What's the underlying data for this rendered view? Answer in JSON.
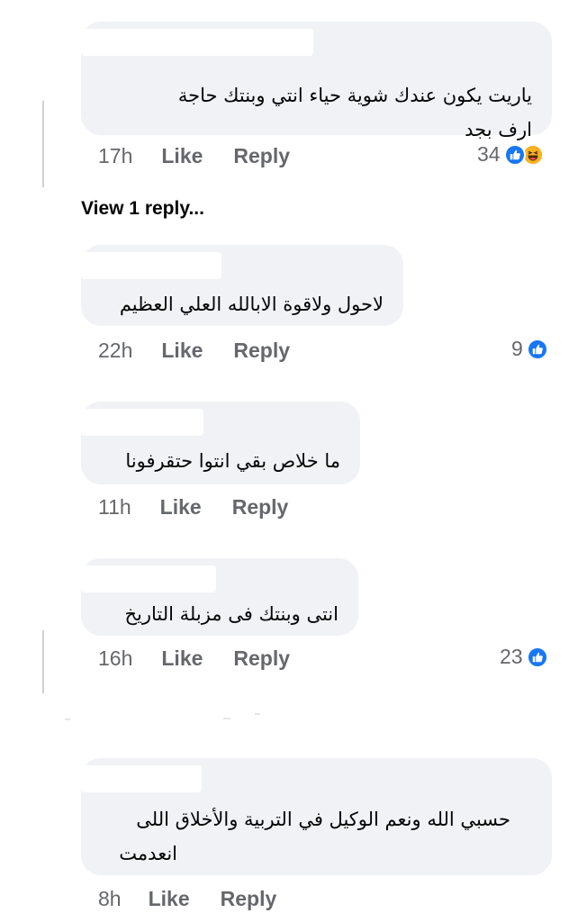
{
  "comments": [
    {
      "text_lines": [
        "ياريت يكون عندك شوية حياء انتي وبنتك حاجة",
        "ارف بجد"
      ],
      "time": "17h",
      "like_label": "Like",
      "reply_label": "Reply",
      "reaction_count": "34",
      "reactions": [
        "like-icon",
        "haha-icon"
      ]
    },
    {
      "text_lines": [
        "لاحول ولاقوة الابالله العلي العظيم"
      ],
      "time": "22h",
      "like_label": "Like",
      "reply_label": "Reply",
      "reaction_count": "9",
      "reactions": [
        "like-icon"
      ]
    },
    {
      "text_lines": [
        "ما خلاص بقي انتوا حتقرفونا"
      ],
      "time": "11h",
      "like_label": "Like",
      "reply_label": "Reply"
    },
    {
      "text_lines": [
        "انتى وبنتك فى مزبلة التاريخ"
      ],
      "time": "16h",
      "like_label": "Like",
      "reply_label": "Reply",
      "reaction_count": "23",
      "reactions": [
        "like-icon"
      ]
    },
    {
      "text_lines": [
        "حسبي الله ونعم الوكيل في التربية والأخلاق اللى",
        "انعدمت"
      ],
      "time": "8h",
      "like_label": "Like",
      "reply_label": "Reply"
    }
  ],
  "view_replies_label": "View 1 reply...",
  "colors": {
    "bubble": "#f0f2f5",
    "meta_text": "#65676b",
    "like_blue": "#1877f2",
    "haha_yellow": "#f7b125"
  }
}
